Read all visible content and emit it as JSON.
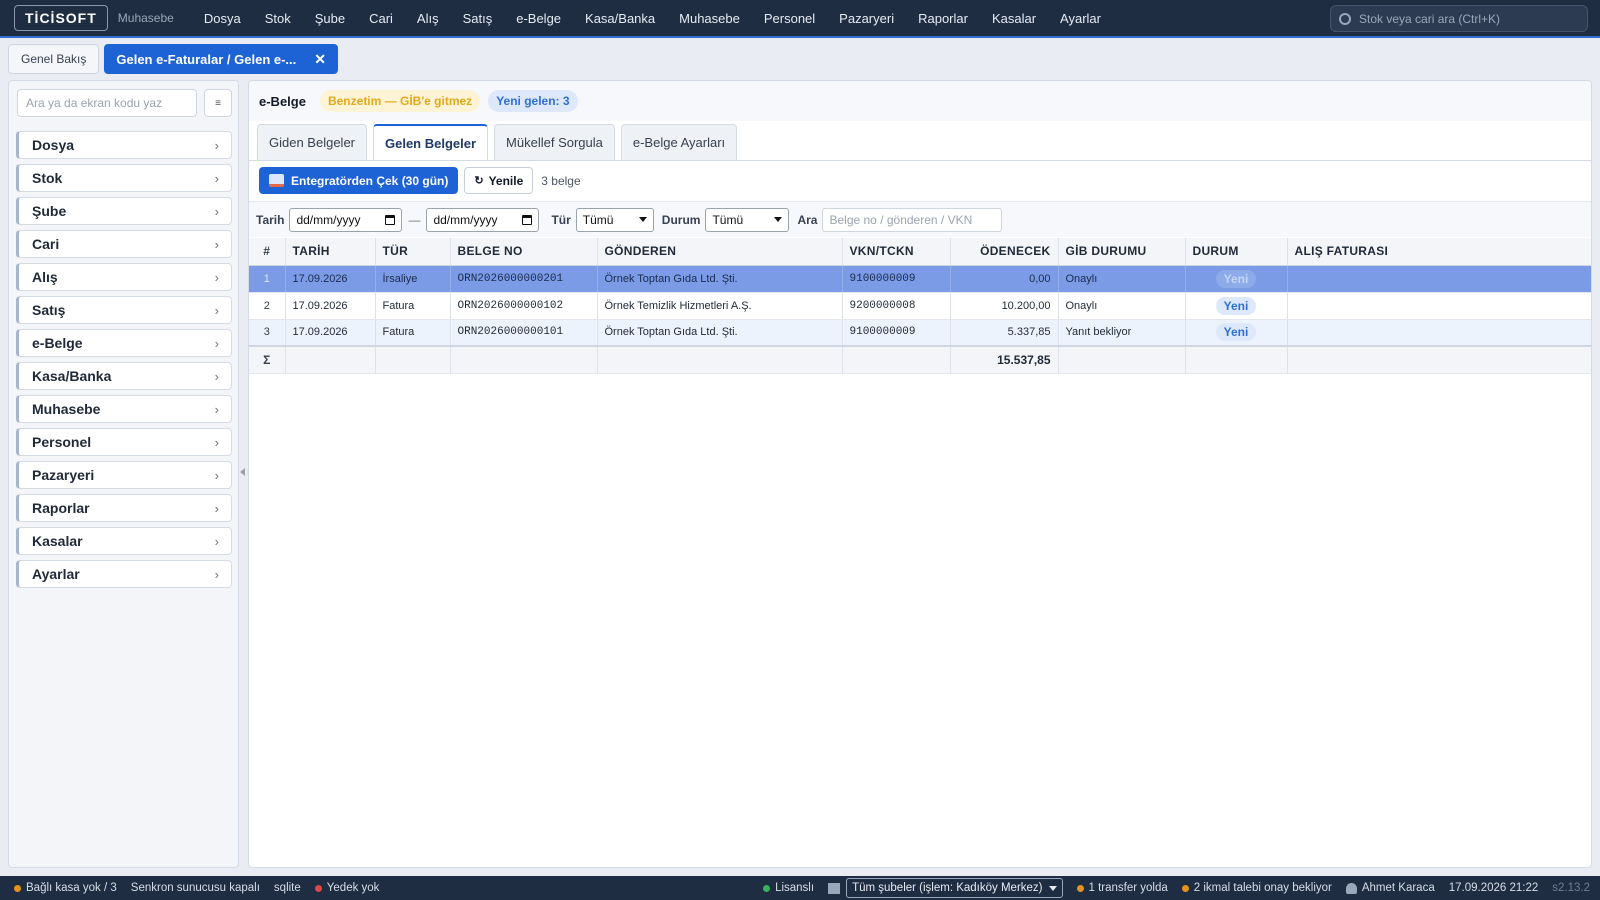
{
  "app": {
    "brand": "TİCİSOFT",
    "subtitle": "Muhasebe",
    "top_menu": [
      "Dosya",
      "Stok",
      "Şube",
      "Cari",
      "Alış",
      "Satış",
      "e-Belge",
      "Kasa/Banka",
      "Muhasebe",
      "Personel",
      "Pazaryeri",
      "Raporlar",
      "Kasalar",
      "Ayarlar"
    ],
    "search_placeholder": "Stok veya cari ara (Ctrl+K)"
  },
  "page_tabs": [
    {
      "label": "Genel Bakış",
      "active": false
    },
    {
      "label": "Gelen e-Faturalar / Gelen e-...",
      "active": true,
      "close": "✕"
    }
  ],
  "sidebar": {
    "search_placeholder": "Ara ya da ekran kodu yaz",
    "button_icon": "≡",
    "items": [
      "Dosya",
      "Stok",
      "Şube",
      "Cari",
      "Alış",
      "Satış",
      "e-Belge",
      "Kasa/Banka",
      "Muhasebe",
      "Personel",
      "Pazaryeri",
      "Raporlar",
      "Kasalar",
      "Ayarlar"
    ],
    "chevron": "›"
  },
  "main": {
    "title": "e-Belge",
    "badge_simulation": "Benzetim — GİB'e gitmez",
    "badge_new": "Yeni gelen: 3",
    "tabs": [
      "Giden Belgeler",
      "Gelen Belgeler",
      "Mükellef Sorgula",
      "e-Belge Ayarları"
    ],
    "active_tab": 1,
    "btn_fetch": "Entegratörden Çek (30 gün)",
    "btn_refresh": "Yenile",
    "refresh_icon": "↻",
    "count_text": "3 belge"
  },
  "filters": {
    "date_label": "Tarih",
    "date_from": "dd/mm/yyyy",
    "date_to": "dd/mm/yyyy",
    "date_separator": "—",
    "type_label": "Tür",
    "type_value": "Tümü",
    "status_label": "Durum",
    "status_value": "Tümü",
    "search_label": "Ara",
    "search_placeholder": "Belge no / gönderen / VKN"
  },
  "table": {
    "columns": [
      "#",
      "TARİH",
      "TÜR",
      "BELGE NO",
      "GÖNDEREN",
      "VKN/TCKN",
      "ÖDENECEK",
      "GİB DURUMU",
      "DURUM",
      "ALIŞ FATURASI"
    ],
    "rows": [
      {
        "no": "1",
        "date": "17.09.2026",
        "type": "İrsaliye",
        "doc_no": "ORN2026000000201",
        "sender": "Örnek Toptan Gıda Ltd. Şti.",
        "vkn": "9100000009",
        "amount": "0,00",
        "gib": "Onaylı",
        "status": "Yeni",
        "invoice": ""
      },
      {
        "no": "2",
        "date": "17.09.2026",
        "type": "Fatura",
        "doc_no": "ORN2026000000102",
        "sender": "Örnek Temizlik Hizmetleri A.Ş.",
        "vkn": "9200000008",
        "amount": "10.200,00",
        "gib": "Onaylı",
        "status": "Yeni",
        "invoice": ""
      },
      {
        "no": "3",
        "date": "17.09.2026",
        "type": "Fatura",
        "doc_no": "ORN2026000000101",
        "sender": "Örnek Toptan Gıda Ltd. Şti.",
        "vkn": "9100000009",
        "amount": "5.337,85",
        "gib": "Yanıt bekliyor",
        "status": "Yeni",
        "invoice": ""
      }
    ],
    "selected_row": 0,
    "total_symbol": "Σ",
    "total_amount": "15.537,85"
  },
  "statusbar": {
    "cash": "Bağlı kasa yok / 3",
    "sync": "Senkron sunucusu kapalı",
    "db": "sqlite",
    "backup": "Yedek yok",
    "license": "Lisanslı",
    "branch_select": "Tüm şubeler (işlem: Kadıköy Merkez)",
    "transfer": "1 transfer yolda",
    "requests": "2 ikmal talebi onay bekliyor",
    "user": "Ahmet Karaca",
    "datetime": "17.09.2026 21:22",
    "version": "s2.13.2"
  },
  "colors": {
    "topbar": "#1f2d42",
    "accent": "#1e63d6",
    "selected_row": "#7b9be6",
    "dot_orange": "#e6921e",
    "dot_red": "#e04646",
    "dot_green": "#35b45a"
  }
}
